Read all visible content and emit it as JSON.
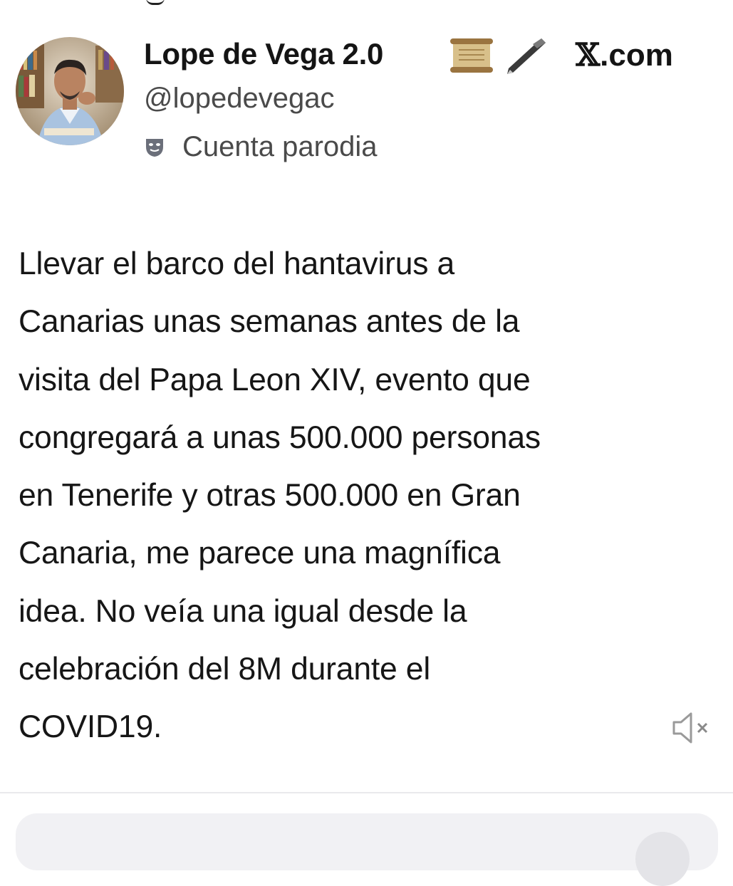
{
  "post": {
    "author": {
      "display_name": "Lope de Vega 2.0",
      "name_icons": [
        "scroll-icon",
        "quill-pen-icon"
      ],
      "handle": "@lopedevegac",
      "label": "Cuenta parodia",
      "label_icon": "theater-masks-icon"
    },
    "source": {
      "x_glyph": "𝕏",
      "domain": ".com"
    },
    "text_lines": [
      "Llevar el barco del hantavirus a",
      "Canarias unas semanas antes de la",
      "visita del Papa Leon XIV, evento que",
      "congregará a unas 500.000 personas",
      "en Tenerife y otras 500.000 en Gran",
      "Canaria, me parece una magnífica",
      "idea. No veía una igual desde la",
      "celebración del 8M durante el",
      "COVID19."
    ],
    "media_control": {
      "icon": "speaker-muted-icon"
    }
  }
}
